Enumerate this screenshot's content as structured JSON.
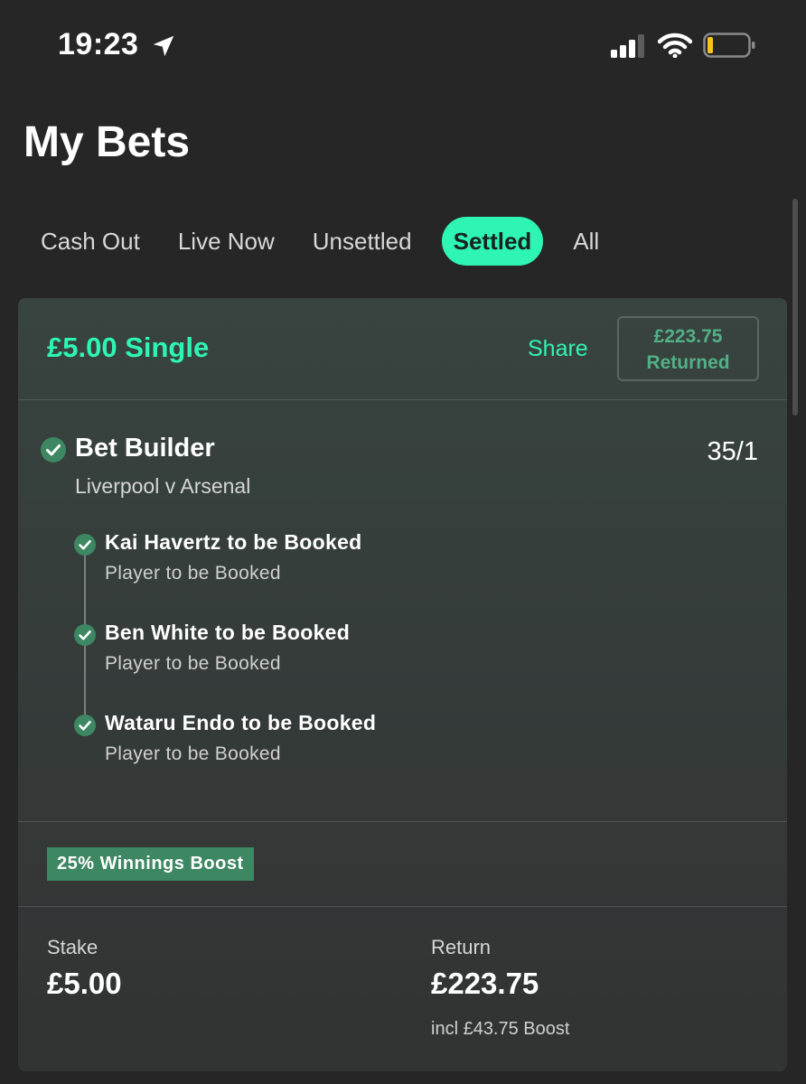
{
  "status_bar": {
    "time": "19:23"
  },
  "page": {
    "title": "My Bets"
  },
  "tabs": [
    {
      "label": "Cash Out",
      "active": false
    },
    {
      "label": "Live Now",
      "active": false
    },
    {
      "label": "Unsettled",
      "active": false
    },
    {
      "label": "Settled",
      "active": true
    },
    {
      "label": "All",
      "active": false
    }
  ],
  "bet": {
    "type": "£5.00 Single",
    "share_label": "Share",
    "returned_amount": "£223.75",
    "returned_label": "Returned",
    "builder_title": "Bet Builder",
    "odds": "35/1",
    "match": "Liverpool v Arsenal",
    "legs": [
      {
        "title": "Kai Havertz to be Booked",
        "market": "Player to be Booked",
        "status": "won"
      },
      {
        "title": "Ben White to be Booked",
        "market": "Player to be Booked",
        "status": "won"
      },
      {
        "title": "Wataru Endo to be Booked",
        "market": "Player to be Booked",
        "status": "won"
      }
    ],
    "boost_badge": "25% Winnings Boost",
    "stake_label": "Stake",
    "stake_value": "£5.00",
    "return_label": "Return",
    "return_value": "£223.75",
    "boost_note": "incl £43.75 Boost"
  },
  "colors": {
    "accent": "#2ff5b4",
    "won": "#3d8763",
    "background": "#262626",
    "card": "#353c3a"
  },
  "icons": {
    "location": "location-arrow-icon",
    "signal": "cellular-signal-icon",
    "wifi": "wifi-icon",
    "battery": "battery-low-icon",
    "check": "check-circle-icon"
  }
}
